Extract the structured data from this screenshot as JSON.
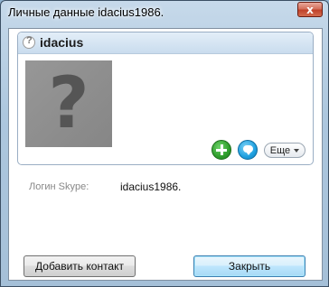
{
  "window": {
    "title": "Личные данные idacius1986.",
    "close_label": "x"
  },
  "profile": {
    "name": "idacius",
    "avatar_placeholder": "?",
    "status_icon": "unknown-status-icon"
  },
  "actions": {
    "add_icon": "plus-circle-icon",
    "chat_icon": "chat-bubble-icon",
    "more_label": "Еще"
  },
  "details": {
    "skype_login_label": "Логин Skype:",
    "skype_login_value": "idacius1986."
  },
  "buttons": {
    "add_contact_label": "Добавить контакт",
    "close_label": "Закрыть"
  },
  "colors": {
    "add_button": "#2e9d2b",
    "chat_button": "#1ea0e0",
    "close_button_border": "#3c7fb1"
  }
}
